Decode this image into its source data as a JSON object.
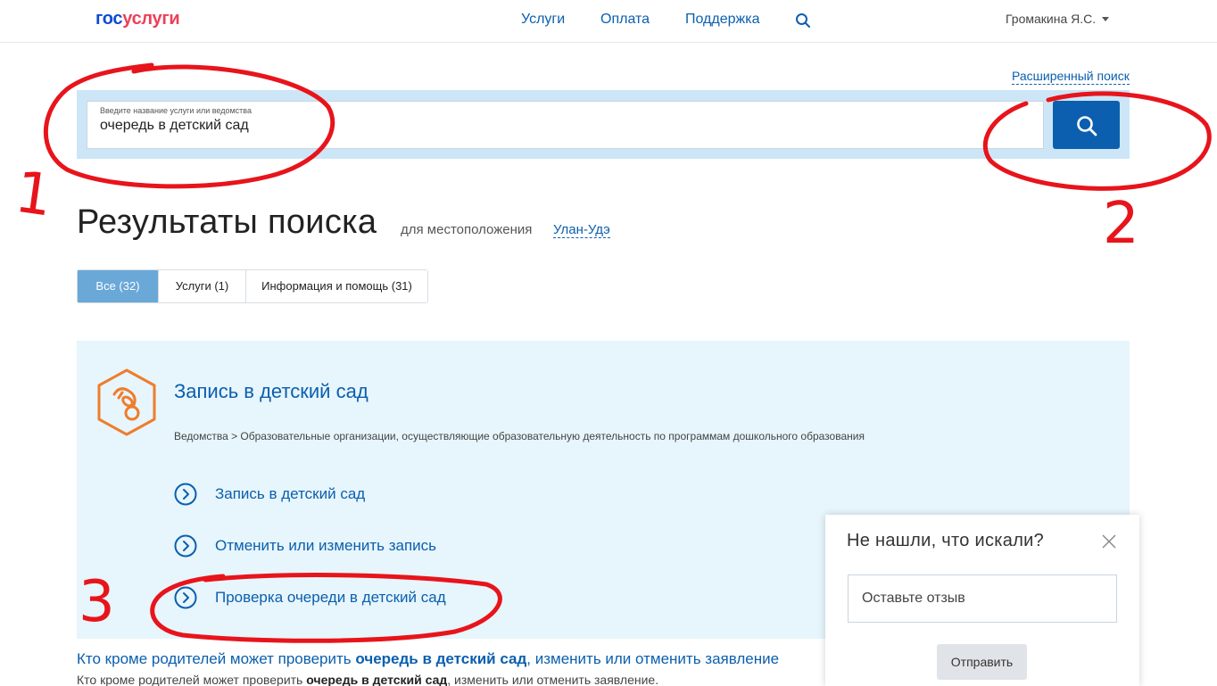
{
  "header": {
    "logo_gos": "гос",
    "logo_usl": "услуги",
    "nav": [
      "Услуги",
      "Оплата",
      "Поддержка"
    ],
    "user": "Громакина Я.С."
  },
  "search": {
    "advanced_link": "Расширенный поиск",
    "placeholder": "Введите название услуги или ведомства",
    "value": "очередь в детский сад"
  },
  "results": {
    "title": "Результаты поиска",
    "location_label": "для местоположения",
    "location_city": "Улан-Удэ",
    "tabs": [
      "Все (32)",
      "Услуги (1)",
      "Информация и помощь (31)"
    ]
  },
  "card": {
    "title": "Запись в детский сад",
    "path": "Ведомства > Образовательные организации, осуществляющие образовательную деятельность по программам дошкольного образования",
    "subitems": [
      "Запись в детский сад",
      "Отменить или изменить запись",
      "Проверка очереди в детский сад"
    ]
  },
  "info": {
    "link_pre": "Кто кроме родителей может проверить ",
    "link_bold": "очередь в детский сад",
    "link_post": ", изменить или отменить заявление",
    "snip_pre": "Кто кроме родителей может проверить ",
    "snip_bold": "очередь в детский сад",
    "snip_post": ", изменить или отменить заявление."
  },
  "feedback": {
    "title": "Не нашли, что искали?",
    "placeholder": "Оставьте отзыв",
    "button": "Отправить"
  },
  "annotations": [
    "1",
    "2",
    "3"
  ],
  "colors": {
    "brand_blue": "#0b5fae",
    "band": "#cce6f8",
    "card": "#e7f5fc",
    "annotation": "#e8141b",
    "icon_orange": "#ee7d2c"
  }
}
